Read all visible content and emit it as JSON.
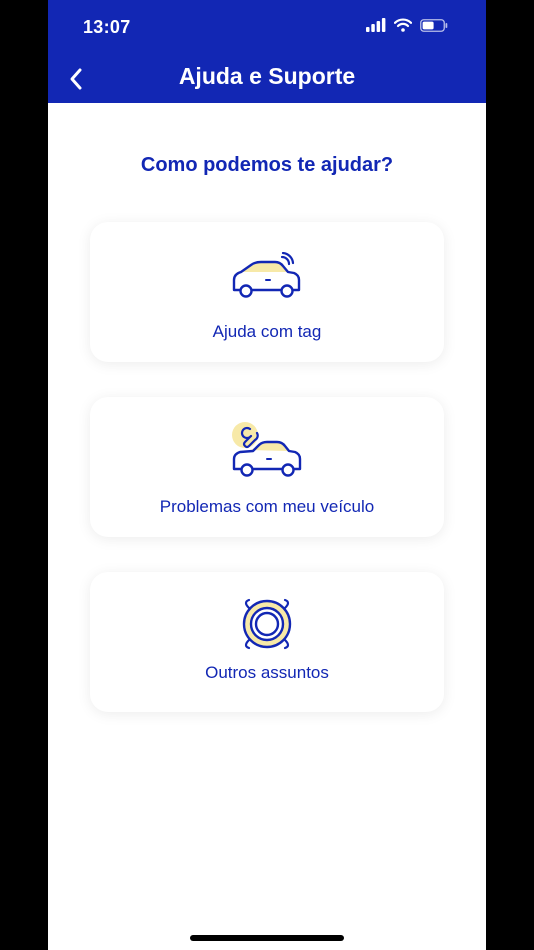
{
  "status_bar": {
    "time": "13:07"
  },
  "header": {
    "title": "Ajuda e Suporte",
    "back_icon": "chevron-left-icon"
  },
  "main": {
    "question": "Como podemos te ajudar?",
    "options": [
      {
        "label": "Ajuda com tag",
        "icon": "car-tag-icon"
      },
      {
        "label": "Problemas com meu veículo",
        "icon": "car-wrench-icon"
      },
      {
        "label": "Outros assuntos",
        "icon": "lifebuoy-icon"
      }
    ]
  },
  "colors": {
    "primary": "#1227b4",
    "accent": "#f7e9a8",
    "background": "#ffffff"
  }
}
